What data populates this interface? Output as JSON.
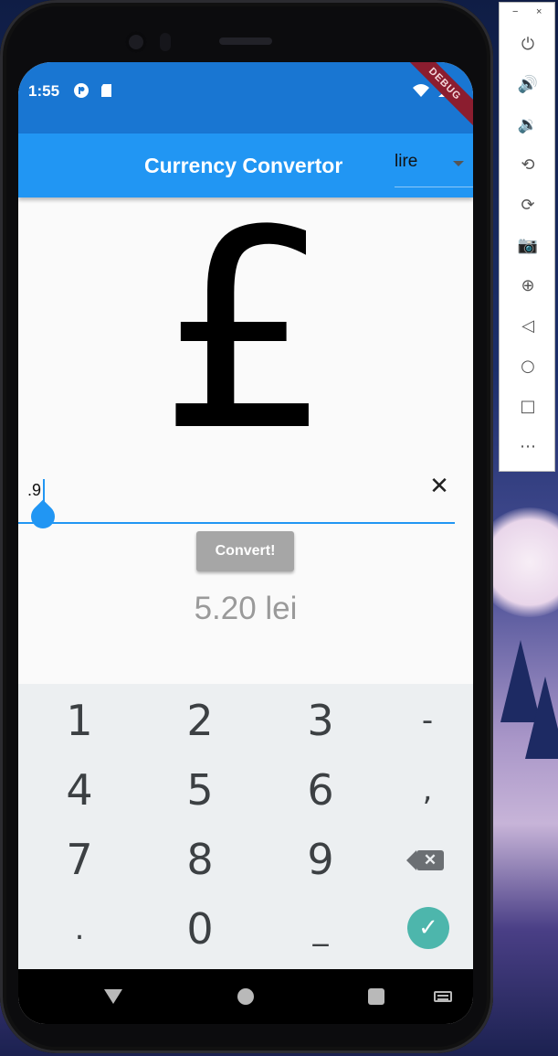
{
  "status_bar": {
    "time": "1:55",
    "debug_banner": "DEBUG"
  },
  "app_bar": {
    "title": "Currency Convertor",
    "currency_dropdown_value": "lire"
  },
  "currency_symbol": "£",
  "amount_input": {
    "value": ".9",
    "clear_icon": "close-icon",
    "clear_glyph": "✕"
  },
  "convert_button_label": "Convert!",
  "result_text": "5.20 lei",
  "keyboard": {
    "rows": [
      [
        "1",
        "2",
        "3",
        "-"
      ],
      [
        "4",
        "5",
        "6",
        ","
      ],
      [
        "7",
        "8",
        "9",
        "⌫"
      ],
      [
        ".",
        "0",
        "_",
        "✓"
      ]
    ],
    "backspace_glyph": "✕",
    "done_glyph": "✓"
  },
  "emulator_panel": {
    "minimize_label": "−",
    "close_label": "×",
    "icons": [
      {
        "name": "power-icon",
        "glyph": "⏻"
      },
      {
        "name": "volume-up-icon",
        "glyph": "🔊"
      },
      {
        "name": "volume-down-icon",
        "glyph": "🔉"
      },
      {
        "name": "rotate-left-icon",
        "glyph": "⟲"
      },
      {
        "name": "rotate-right-icon",
        "glyph": "⟳"
      },
      {
        "name": "camera-icon",
        "glyph": "📷"
      },
      {
        "name": "zoom-icon",
        "glyph": "⊕"
      },
      {
        "name": "back-icon",
        "glyph": "◁"
      },
      {
        "name": "home-icon",
        "glyph": "○"
      },
      {
        "name": "overview-icon",
        "glyph": "□"
      },
      {
        "name": "more-icon",
        "glyph": "⋯"
      }
    ]
  },
  "colors": {
    "status_bar": "#1976d2",
    "app_bar": "#2196f3",
    "accent": "#2196f3",
    "convert_button": "#a6a6a6",
    "keyboard_bg": "#eceff1",
    "done_key": "#4db6ac",
    "debug_ribbon": "#8b1d2f"
  }
}
